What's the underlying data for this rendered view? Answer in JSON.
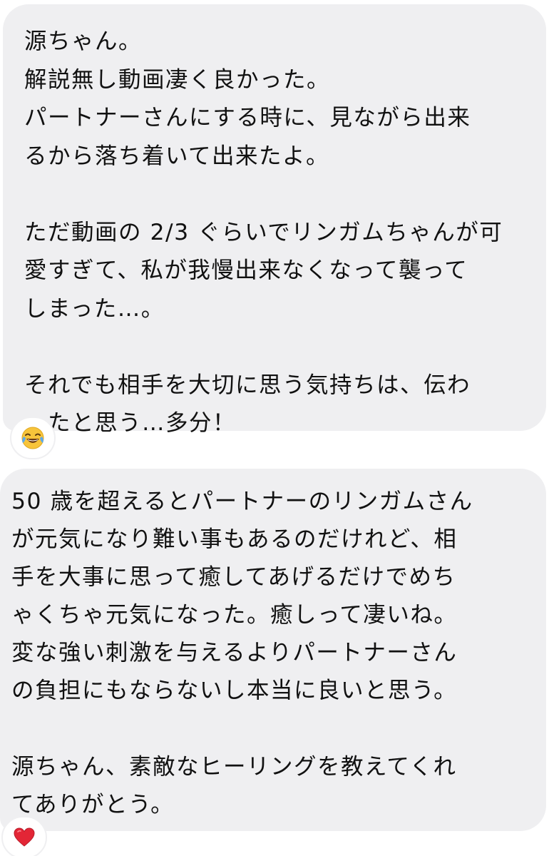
{
  "messages": [
    {
      "lines": [
        "源ちゃん。",
        "解説無し動画凄く良かった。",
        "パートナーさんにする時に、見ながら出来",
        "るから落ち着いて出来たよ。",
        "",
        "ただ動画の 2/3 ぐらいでリンガムちゃんが可",
        "愛すぎて、私が我慢出来なくなって襲って",
        "しまった…。",
        "",
        "それでも相手を大切に思う気持ちは、伝わ",
        "ったと思う…多分！"
      ],
      "reaction": "face-with-tears-of-joy"
    },
    {
      "lines": [
        "50 歳を超えるとパートナーのリンガムさん",
        "が元気になり難い事もあるのだけれど、相",
        "手を大事に思って癒してあげるだけでめち",
        "ゃくちゃ元気になった。癒しって凄いね。",
        "変な強い刺激を与えるよりパートナーさん",
        "の負担にもならないし本当に良いと思う。",
        "",
        "源ちゃん、素敵なヒーリングを教えてくれ",
        "てありがとう。"
      ],
      "reaction": "red-heart"
    }
  ],
  "colors": {
    "bubble_background": "#efeff1",
    "text": "#111111",
    "page_background": "#ffffff"
  }
}
